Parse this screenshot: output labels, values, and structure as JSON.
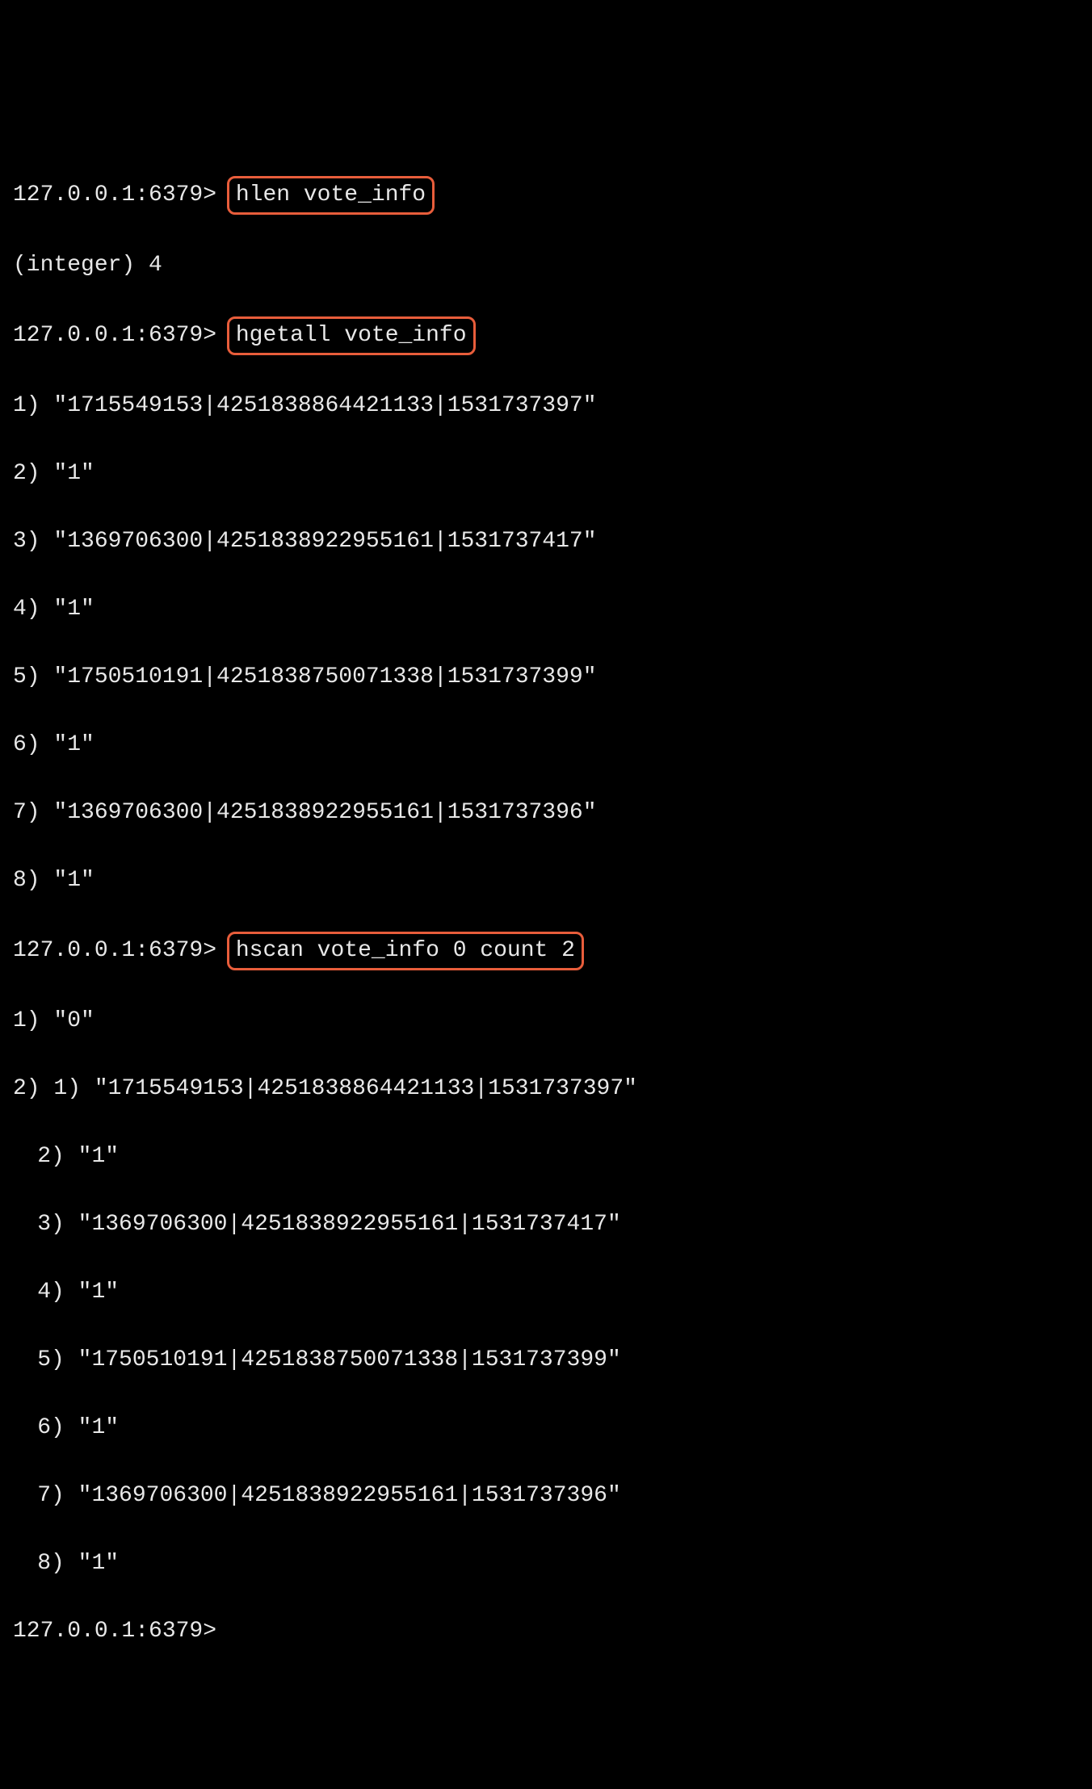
{
  "prompt": "127.0.0.1:6379>",
  "commands": {
    "cmd1": "hlen vote_info",
    "cmd2": "hgetall vote_info",
    "cmd3": "hscan vote_info 0 count 2"
  },
  "outputs": {
    "hlen_result": "(integer) 4",
    "hgetall_lines": [
      "1) \"1715549153|4251838864421133|1531737397\"",
      "2) \"1\"",
      "3) \"1369706300|4251838922955161|1531737417\"",
      "4) \"1\"",
      "5) \"1750510191|4251838750071338|1531737399\"",
      "6) \"1\"",
      "7) \"1369706300|4251838922955161|1531737396\"",
      "8) \"1\""
    ],
    "hscan_line1": "1) \"0\"",
    "hscan_line2_prefix": "2) ",
    "hscan_nested": [
      "1) \"1715549153|4251838864421133|1531737397\"",
      "2) \"1\"",
      "3) \"1369706300|4251838922955161|1531737417\"",
      "4) \"1\"",
      "5) \"1750510191|4251838750071338|1531737399\"",
      "6) \"1\"",
      "7) \"1369706300|4251838922955161|1531737396\"",
      "8) \"1\""
    ]
  }
}
